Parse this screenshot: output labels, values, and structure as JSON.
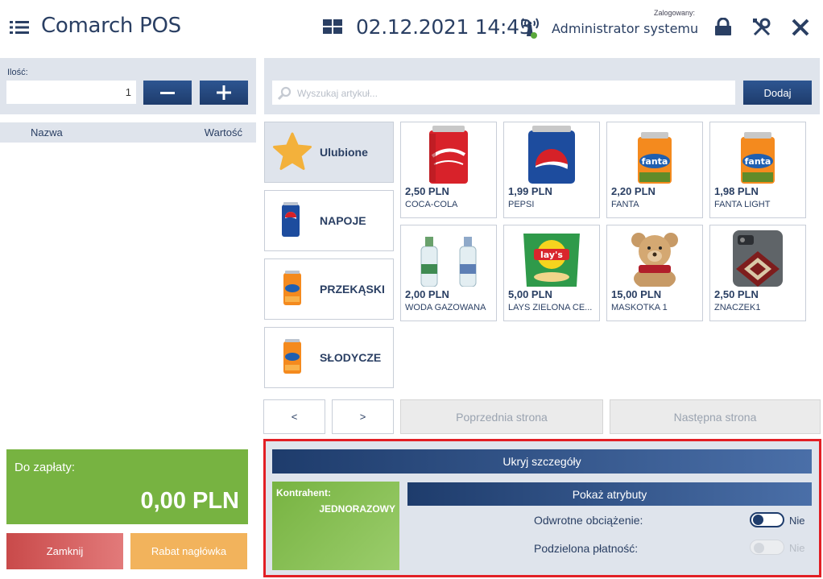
{
  "header": {
    "app_title": "Comarch POS",
    "datetime": "02.12.2021 14:43",
    "logged_label": "Zalogowany:",
    "user_name": "Administrator systemu"
  },
  "quantity": {
    "label": "Ilość:",
    "value": "1"
  },
  "cart": {
    "col_name": "Nazwa",
    "col_value": "Wartość"
  },
  "payment": {
    "label": "Do zapłaty:",
    "amount": "0,00 PLN"
  },
  "actions": {
    "close_label": "Zamknij",
    "discount_label": "Rabat nagłówka"
  },
  "search": {
    "placeholder": "Wyszukaj artykuł...",
    "add_label": "Dodaj"
  },
  "categories": [
    {
      "label": "Ulubione",
      "icon": "star-icon"
    },
    {
      "label": "NAPOJE",
      "icon": "pepsi-can-icon"
    },
    {
      "label": "PRZEKĄSKI",
      "icon": "fanta-can-icon"
    },
    {
      "label": "SŁODYCZE",
      "icon": "fanta-can-icon"
    }
  ],
  "products": [
    {
      "price": "2,50 PLN",
      "name": "COCA-COLA",
      "icon": "coca-cola-can-icon"
    },
    {
      "price": "1,99 PLN",
      "name": "PEPSI",
      "icon": "pepsi-can-icon"
    },
    {
      "price": "2,20 PLN",
      "name": "FANTA",
      "icon": "fanta-can-icon"
    },
    {
      "price": "1,98 PLN",
      "name": "FANTA LIGHT",
      "icon": "fanta-can-icon"
    },
    {
      "price": "2,00 PLN",
      "name": "WODA GAZOWANA",
      "icon": "water-bottles-icon"
    },
    {
      "price": "5,00 PLN",
      "name": "LAYS ZIELONA CE...",
      "icon": "lays-bag-icon"
    },
    {
      "price": "15,00 PLN",
      "name": "MASKOTKA 1",
      "icon": "teddy-bear-icon"
    },
    {
      "price": "2,50 PLN",
      "name": "ZNACZEK1",
      "icon": "phone-case-icon"
    }
  ],
  "pagination": {
    "prev_small": "<",
    "next_small": ">",
    "prev_page": "Poprzednia strona",
    "next_page": "Następna strona"
  },
  "details": {
    "hide_label": "Ukryj szczegóły",
    "contractor_label": "Kontrahent:",
    "contractor_value": "JEDNORAZOWY",
    "attributes_label": "Pokaż atrybuty",
    "reverse_charge_label": "Odwrotne obciążenie:",
    "reverse_charge_value": "Nie",
    "split_payment_label": "Podzielona płatność:",
    "split_payment_value": "Nie"
  },
  "colors": {
    "accent_dark_blue": "#1e3c6c",
    "pay_green": "#77b341",
    "close_red": "#c94a4a",
    "discount_orange": "#f2b35c",
    "highlight_red": "#e21f25"
  }
}
